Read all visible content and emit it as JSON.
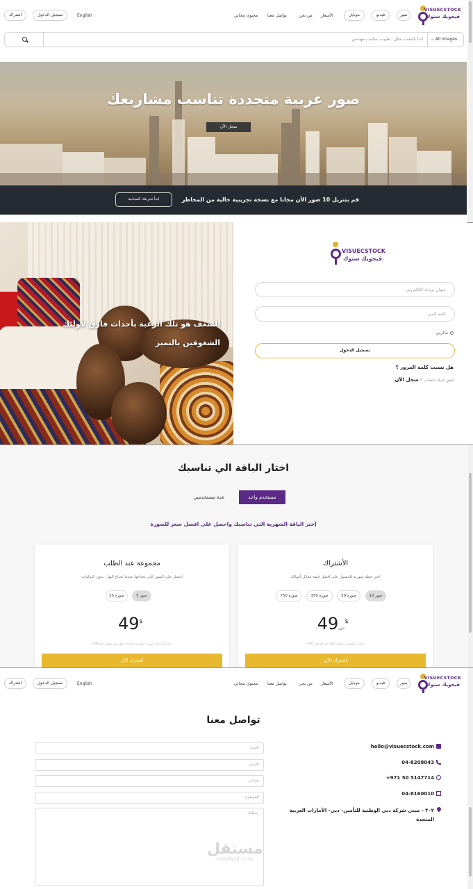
{
  "brand": {
    "name_en": "VISUECSTOCK",
    "name_ar": "ڤيجويك ستوك"
  },
  "header": {
    "nav": [
      "صور",
      "فيديو",
      "موبايل",
      "الأسعار",
      "من نحن",
      "تواصل معنا",
      "محتوى مجاني"
    ],
    "lang": "English",
    "login": "تسجيل الدخول",
    "subscribe": "اشتراك"
  },
  "search": {
    "placeholder": "ابدأ بالبحث, مثال : طبيب, مكتب, مهندس",
    "category": "All images"
  },
  "hero": {
    "title": "صور عربية متجددة تناسب مشاريعك",
    "button": "سجل الآن",
    "trial_text": "قم بتنزيل 10 صور الآن مجانا مع نسخة تجريبية خالية من المخاطر",
    "trial_button": "ابدأ تجربتك المجانية"
  },
  "login": {
    "quote_line1": "الشغف هو تلك الرغبة بأحداث فارق لأولئك",
    "quote_line2": "الشغوفين بالتميز",
    "email_placeholder": "عنوان بريدك الالكتروني",
    "password_placeholder": "كلمة السر",
    "remember": "تذكرني",
    "submit": "تسجيل الدخول",
    "forgot": "هل نسيت كلمة المرور ؟",
    "no_account": "ليس لديك حساب ؟",
    "register": "سجل الآن"
  },
  "pricing": {
    "title": "اختار الباقة الي تناسبك",
    "tab_single": "مستخدم واحد",
    "tab_multi": "عدة مستخدمين",
    "subtitle": "إختر الباقة الشهرية التي تناسبك واحصل على افضل سعر للصورة",
    "plans": [
      {
        "title": "الأشتراك",
        "desc": "اختر خطة شهرية للحصول على افضل قيمة مقابل أموالك",
        "options": [
          "10 صور",
          "50 صورة",
          "350 صورة",
          "750 صورة"
        ],
        "selected": 0,
        "price": "49",
        "currency": "$",
        "per": "/شهر",
        "note": "4.90 دولارات للصورة - يمكنك الإلغاء في أي وقت",
        "button": "اشترك الآن"
      },
      {
        "title": "مجموعة عند الطلب",
        "desc": "احصل على الصور التي تحتاجها عندما تحتاج اليها - بدون التزامات",
        "options": [
          "5 صور",
          "25 صورة"
        ],
        "selected": 0,
        "price": "49",
        "currency": "$",
        "per": "",
        "note": "9.80 دولارا أمريكيا / صورة - دفع لمرة واحدة - تنتهي في غضون عام",
        "button": "اشترك الآن"
      }
    ]
  },
  "contact": {
    "title": "تواصل معنا",
    "fields": [
      "الأسم",
      "الأيميل",
      "موبايل",
      "الموضوع",
      "رسالتك"
    ],
    "email": "hello@visuecstock.com",
    "phone": "04-8208043",
    "whatsapp": "+971 50 5147714",
    "fax": "04-8160010",
    "address": "٣٠٢ - مبنى شركة دبي الوطنية للتأمين- دبي- الأمارات العربية المتحدة"
  },
  "watermark": {
    "ar": "مستقل",
    "en": "mostaql.com"
  },
  "colors": {
    "brand_purple": "#5b2a86",
    "accent_gold": "#e8b92e",
    "dark_bar": "#262a33"
  }
}
